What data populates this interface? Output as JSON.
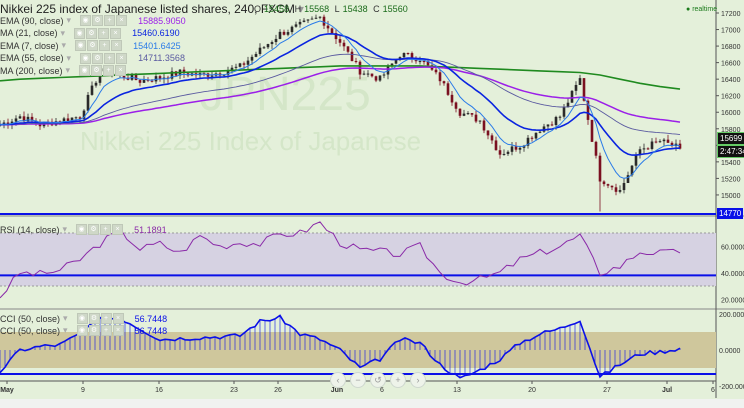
{
  "header": {
    "title": "Nikkei 225 index of Japanese listed shares, 240, FXCM",
    "ohlc": {
      "o_label": "O",
      "o": "15458",
      "h_label": "H",
      "h": "15568",
      "l_label": "L",
      "l": "15438",
      "c_label": "C",
      "c": "15560"
    },
    "realtime": "realtime"
  },
  "watermark": {
    "symbol": "JPN225",
    "description": "Nikkei 225 Index of Japanese"
  },
  "indicators": [
    {
      "label": "EMA (90, close)",
      "value": "15885.9050",
      "color": "#9b1fe8"
    },
    {
      "label": "MA (21, close)",
      "value": "15460.6190",
      "color": "#0a24e0"
    },
    {
      "label": "EMA (7, close)",
      "value": "15401.6425",
      "color": "#2a7be8"
    },
    {
      "label": "EMA (55, close)",
      "value": "14711.3568",
      "color": "#5a5aa0"
    },
    {
      "label": "MA (200, close)",
      "value": "",
      "color": "#1f8a1f"
    }
  ],
  "rsi_legend": {
    "label": "RSI (14, close)",
    "value": "51.1891"
  },
  "cci_legends": [
    {
      "label": "CCI (50, close)",
      "value": "56.7448"
    },
    {
      "label": "CCI (50, close)",
      "value": "56.7448"
    }
  ],
  "price_tags": {
    "last": "15699",
    "countdown": "2:47:34",
    "hline": "14770"
  },
  "nav_buttons": [
    "‹",
    "−",
    "↺",
    "+",
    "›"
  ],
  "colors": {
    "background": "#e4f0da",
    "up": "#2a2a2a",
    "down": "#7a1020",
    "rsi": "#8a2aa8",
    "cci": "#0a10e8",
    "hline": "#0a10e8"
  },
  "chart_data": [
    {
      "type": "candlestick",
      "title": "Nikkei 225 index of Japanese listed shares, 240, FXCM",
      "x_ticks": [
        "May",
        "9",
        "16",
        "23",
        "26",
        "Jun",
        "6",
        "13",
        "20",
        "27",
        "Jul",
        "6"
      ],
      "y_ticks": [
        "17200",
        "17000",
        "16800",
        "16600",
        "16400",
        "16200",
        "16000",
        "15800",
        "15600",
        "15400",
        "15200",
        "15000"
      ],
      "ylim": [
        14770,
        17300
      ],
      "close": [
        15850,
        15950,
        15850,
        15900,
        15950,
        16500,
        16450,
        16380,
        16420,
        16480,
        16450,
        16480,
        16550,
        16750,
        16950,
        17050,
        17150,
        16850,
        16500,
        16400,
        16700,
        16650,
        16400,
        16000,
        15900,
        15500,
        15600,
        15800,
        15950,
        16400,
        15200,
        15050,
        15550,
        15650,
        15560
      ],
      "ma200": [
        16380,
        16400,
        16410,
        16420,
        16430,
        16440,
        16450,
        16460,
        16470,
        16480,
        16490,
        16500,
        16510,
        16520,
        16530,
        16540,
        16550,
        16560,
        16560,
        16560,
        16560,
        16560,
        16550,
        16540,
        16530,
        16520,
        16510,
        16500,
        16490,
        16480,
        16450,
        16400,
        16350,
        16310,
        16280
      ],
      "hline": 14770
    },
    {
      "type": "line",
      "title": "RSI (14, close)",
      "y_ticks": [
        "60.0000",
        "40.0000",
        "20.0000"
      ],
      "band": [
        30,
        70
      ],
      "hline": 38,
      "values": [
        22,
        40,
        39,
        42,
        50,
        62,
        72,
        58,
        62,
        55,
        68,
        60,
        63,
        62,
        69,
        70,
        78,
        63,
        57,
        56,
        54,
        60,
        40,
        33,
        35,
        40,
        50,
        55,
        60,
        68,
        40,
        45,
        56,
        55,
        55
      ]
    },
    {
      "type": "bar",
      "title": "CCI (50, close)",
      "y_ticks": [
        "200.0000",
        "0.0000",
        "-200.0000"
      ],
      "band": [
        -100,
        100
      ],
      "hline": -133,
      "values": [
        -120,
        0,
        20,
        30,
        90,
        170,
        180,
        120,
        60,
        65,
        70,
        75,
        80,
        160,
        180,
        90,
        60,
        0,
        -100,
        -50,
        60,
        40,
        -80,
        -160,
        -110,
        -50,
        40,
        90,
        120,
        170,
        -150,
        -80,
        -20,
        -10,
        10
      ]
    }
  ]
}
